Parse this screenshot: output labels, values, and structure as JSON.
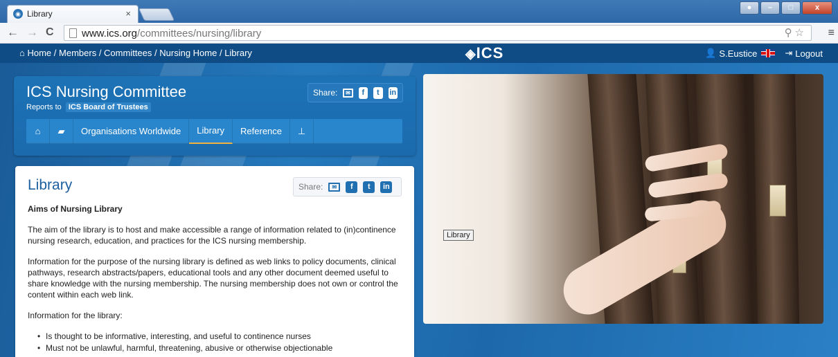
{
  "browser": {
    "tab_title": "Library",
    "tab_close": "×",
    "url_host": "www.ics.org",
    "url_path": "/committees/nursing/library",
    "back": "←",
    "forward": "→",
    "reload": "C",
    "omni_icons": "⚲☆",
    "menu": "≡"
  },
  "header": {
    "breadcrumb": [
      "Home",
      "Members",
      "Committees",
      "Nursing Home",
      "Library"
    ],
    "logo": "ICS",
    "user": "S.Eustice",
    "logout": "Logout"
  },
  "committee": {
    "title": "ICS Nursing Committee",
    "reports_to_label": "Reports to",
    "reports_to": "ICS Board of Trustees",
    "share_label": "Share:",
    "nav": [
      {
        "label": "",
        "icon": "home-icon"
      },
      {
        "label": "",
        "icon": "folder-icon"
      },
      {
        "label": "Organisations Worldwide"
      },
      {
        "label": "Library",
        "active": true
      },
      {
        "label": "Reference"
      },
      {
        "label": "",
        "icon": "sitemap-icon"
      }
    ]
  },
  "library": {
    "title": "Library",
    "share_label": "Share:",
    "heading": "Aims of Nursing Library",
    "para1": "The aim of the library is to host and make accessible a range of information related to (in)continence nursing research, education, and practices for the ICS nursing membership.",
    "para2": "Information for the purpose of the nursing library is defined as web links to policy documents, clinical pathways, research abstracts/papers, educational tools and any other document deemed useful to share knowledge with the nursing membership. The nursing membership does not own or control the content within each web link.",
    "para3": "Information for the library:",
    "bullets": [
      "Is thought to be informative, interesting, and useful to continence nurses",
      "Must not be unlawful, harmful, threatening, abusive or otherwise objectionable"
    ]
  },
  "hero": {
    "tooltip": "Library"
  }
}
